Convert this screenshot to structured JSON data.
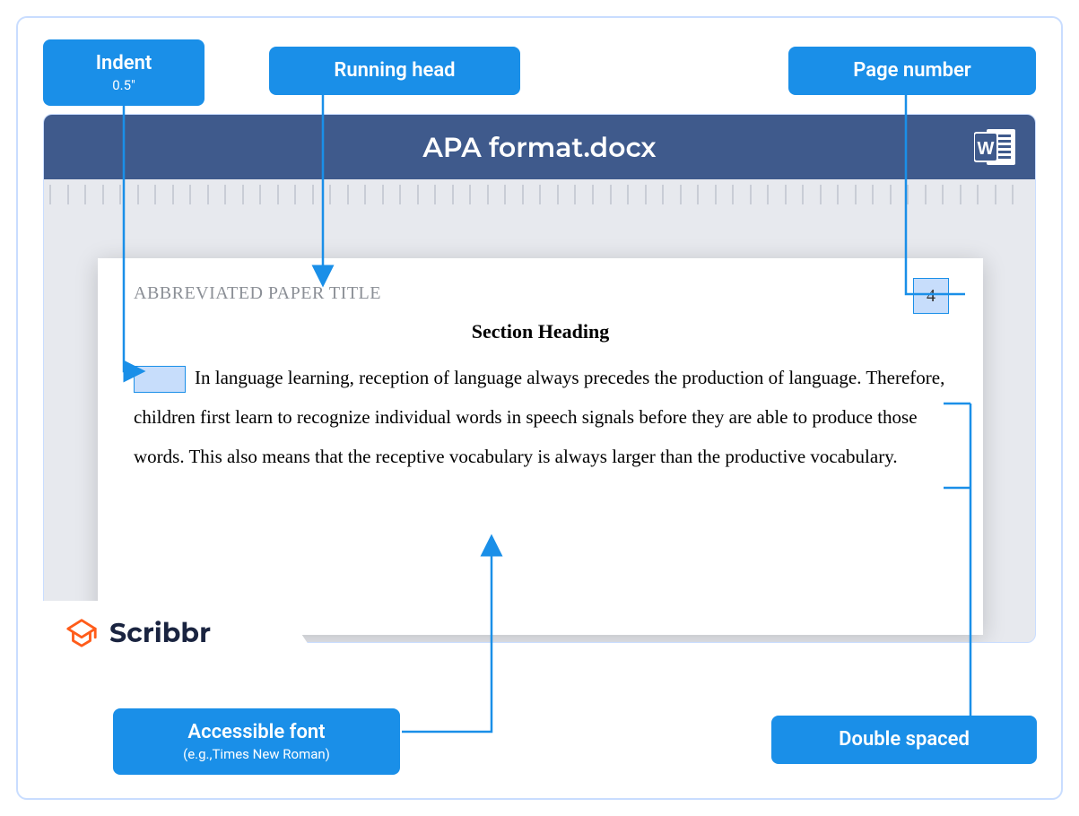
{
  "labels": {
    "indent": {
      "title": "Indent",
      "sub": "0.5\""
    },
    "running_head": "Running head",
    "page_number": "Page number",
    "accessible_font": {
      "title": "Accessible font",
      "sub": "(e.g.,Times New Roman)"
    },
    "double_spaced": "Double spaced"
  },
  "document": {
    "filename": "APA format.docx",
    "running_head": "ABBREVIATED PAPER TITLE",
    "page_number": "4",
    "section_heading": "Section Heading",
    "body": "In language learning, reception of language always precedes the production of language. Therefore, children first learn to recognize individual words in speech signals before they are able to produce those words. This also means that the receptive vocabulary is always larger than the productive vocabulary."
  },
  "brand": "Scribbr"
}
